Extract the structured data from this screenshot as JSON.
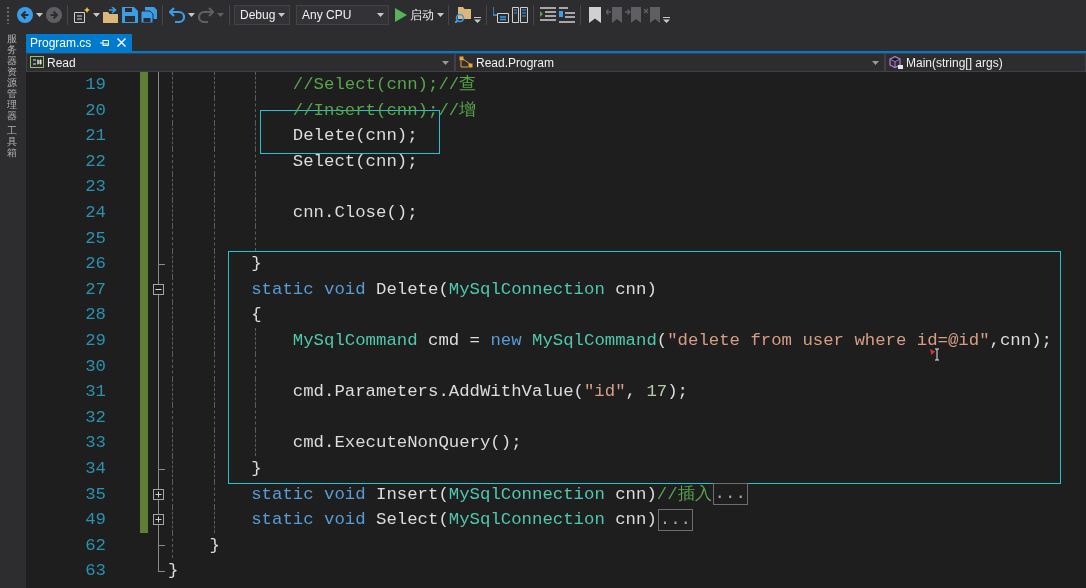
{
  "toolbar": {
    "left_groups": [
      {
        "items": [
          {
            "kind": "back",
            "disabled": false
          },
          {
            "kind": "caret",
            "disabled": false
          },
          {
            "kind": "forward",
            "disabled": true
          }
        ]
      },
      {
        "items": [
          {
            "kind": "new_project",
            "disabled": false
          },
          {
            "kind": "caret",
            "disabled": false
          },
          {
            "kind": "open",
            "disabled": false
          },
          {
            "kind": "save",
            "disabled": false
          },
          {
            "kind": "save_all",
            "disabled": false
          }
        ]
      },
      {
        "items": [
          {
            "kind": "undo",
            "disabled": false
          },
          {
            "kind": "caret",
            "disabled": false
          },
          {
            "kind": "redo",
            "disabled": true
          },
          {
            "kind": "caret",
            "disabled": true
          }
        ]
      }
    ],
    "configuration": "Debug",
    "platform": "Any CPU",
    "start_button": "启动",
    "right_groups": [
      {
        "items": [
          {
            "kind": "find",
            "disabled": false
          },
          {
            "kind": "overflow",
            "disabled": false
          }
        ]
      },
      {
        "items": [
          {
            "kind": "frame_arrow",
            "disabled": false
          },
          {
            "kind": "panel",
            "disabled": false
          }
        ]
      },
      {
        "items": [
          {
            "kind": "indent_lines",
            "disabled": false
          },
          {
            "kind": "comment_lines",
            "disabled": false
          }
        ]
      },
      {
        "items": [
          {
            "kind": "bookmark",
            "disabled": false
          },
          {
            "kind": "bookmark_prev",
            "disabled": true
          },
          {
            "kind": "bookmark_next",
            "disabled": true
          },
          {
            "kind": "bookmark_clear",
            "disabled": true
          },
          {
            "kind": "overflow",
            "disabled": false
          }
        ]
      }
    ]
  },
  "side_tabs": [
    {
      "label": "服务器资源管理器"
    },
    {
      "label": "工具箱"
    }
  ],
  "tabs": [
    {
      "label": "Program.cs",
      "selected": true
    }
  ],
  "navigation": [
    {
      "kind": "file",
      "text": "Read"
    },
    {
      "kind": "class",
      "text": "Read.Program"
    },
    {
      "kind": "method",
      "text": "Main(string[] args)"
    }
  ],
  "editor": {
    "lines": [
      {
        "children": [
          {
            "children": [
              {
                "children": [
                  {
                    "number": "19",
                    "changed": true,
                    "tokens": [
                      {
                        "kind": "comment",
                        "text": "//Select(cnn);//查"
                      }
                    ]
                  },
                  {
                    "number": "20",
                    "changed": true,
                    "tokens": [
                      {
                        "kind": "comment",
                        "text": "//Insert(cnn);//增"
                      }
                    ]
                  },
                  {
                    "number": "21",
                    "changed": true,
                    "tokens": [
                      {
                        "kind": "plain",
                        "text": "Delete(cnn);"
                      }
                    ]
                  },
                  {
                    "number": "22",
                    "changed": true,
                    "tokens": [
                      {
                        "kind": "plain",
                        "text": "Select(cnn);"
                      }
                    ]
                  },
                  {
                    "number": "23",
                    "changed": true
                  },
                  {
                    "number": "24",
                    "changed": true,
                    "tokens": [
                      {
                        "kind": "plain",
                        "text": "cnn.Close();"
                      }
                    ]
                  },
                  {
                    "number": "25",
                    "changed": true
                  }
                ]
              },
              {
                "number": "26",
                "changed": true,
                "fold_end": true,
                "tokens": [
                  {
                    "kind": "plain",
                    "text": "}"
                  }
                ]
              },
              {
                "number": "27",
                "changed": true,
                "fold": {
                  "expanded": true
                },
                "tokens": [
                  {
                    "kind": "keyword",
                    "text": "static "
                  },
                  {
                    "kind": "keyword",
                    "text": "void"
                  },
                  {
                    "kind": "plain",
                    "text": " Delete("
                  },
                  {
                    "kind": "type",
                    "text": "MySqlConnection"
                  },
                  {
                    "kind": "plain",
                    "text": " cnn)"
                  }
                ]
              },
              {
                "number": "28",
                "changed": true,
                "tokens": [
                  {
                    "kind": "plain",
                    "text": "{"
                  }
                ]
              },
              {
                "children": [
                  {
                    "number": "29",
                    "changed": true,
                    "tokens": [
                      {
                        "kind": "type",
                        "text": "MySqlCommand"
                      },
                      {
                        "kind": "plain",
                        "text": " cmd = "
                      },
                      {
                        "kind": "keyword",
                        "text": "new "
                      },
                      {
                        "kind": "type",
                        "text": "MySqlCommand"
                      },
                      {
                        "kind": "plain",
                        "text": "("
                      },
                      {
                        "kind": "string",
                        "text": "\"delete from user where id=@id\""
                      },
                      {
                        "kind": "plain",
                        "text": ",cnn);"
                      }
                    ]
                  },
                  {
                    "number": "30",
                    "changed": true
                  },
                  {
                    "number": "31",
                    "changed": true,
                    "tokens": [
                      {
                        "kind": "plain",
                        "text": "cmd.Parameters.AddWithValue("
                      },
                      {
                        "kind": "string",
                        "text": "\"id\""
                      },
                      {
                        "kind": "plain",
                        "text": ", "
                      },
                      {
                        "kind": "number",
                        "text": "17"
                      },
                      {
                        "kind": "plain",
                        "text": ");"
                      }
                    ]
                  },
                  {
                    "number": "32",
                    "changed": true
                  },
                  {
                    "number": "33",
                    "changed": true,
                    "tokens": [
                      {
                        "kind": "plain",
                        "text": "cmd.ExecuteNonQuery();"
                      }
                    ]
                  }
                ]
              },
              {
                "number": "34",
                "changed": true,
                "fold_end": true,
                "tokens": [
                  {
                    "kind": "plain",
                    "text": "}"
                  }
                ]
              },
              {
                "number": "35",
                "changed": true,
                "fold": {
                  "expanded": false
                },
                "collapsed_text": "...",
                "tokens": [
                  {
                    "kind": "keyword",
                    "text": "static "
                  },
                  {
                    "kind": "keyword",
                    "text": "void"
                  },
                  {
                    "kind": "plain",
                    "text": " Insert("
                  },
                  {
                    "kind": "type",
                    "text": "MySqlConnection"
                  },
                  {
                    "kind": "plain",
                    "text": " cnn)"
                  },
                  {
                    "kind": "comment",
                    "text": "//插入"
                  }
                ]
              },
              {
                "number": "49",
                "changed": true,
                "fold": {
                  "expanded": false
                },
                "collapsed_text": "...",
                "tokens": [
                  {
                    "kind": "keyword",
                    "text": "static "
                  },
                  {
                    "kind": "keyword",
                    "text": "void"
                  },
                  {
                    "kind": "plain",
                    "text": " Select("
                  },
                  {
                    "kind": "type",
                    "text": "MySqlConnection"
                  },
                  {
                    "kind": "plain",
                    "text": " cnn)"
                  }
                ]
              }
            ]
          },
          {
            "number": "62",
            "changed": false,
            "fold_end": true,
            "tokens": [
              {
                "kind": "plain",
                "text": "}"
              }
            ]
          }
        ]
      },
      {
        "number": "63",
        "changed": false,
        "fold_end": true,
        "tokens": [
          {
            "kind": "plain",
            "text": "}"
          }
        ]
      }
    ]
  }
}
